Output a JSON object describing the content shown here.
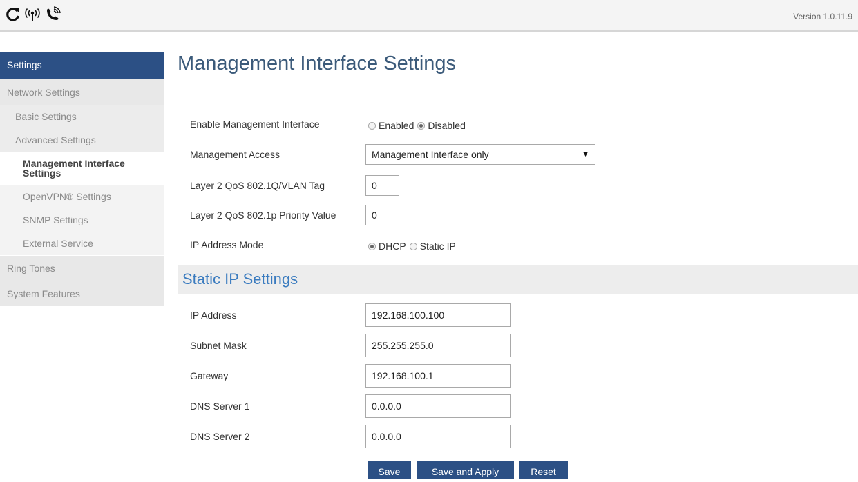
{
  "header": {
    "version": "Version 1.0.11.9"
  },
  "sidebar": {
    "title": "Settings",
    "items": [
      {
        "label": "Network Settings"
      },
      {
        "label": "Basic Settings"
      },
      {
        "label": "Advanced Settings"
      },
      {
        "label": "Management Interface Settings"
      },
      {
        "label": "OpenVPN® Settings"
      },
      {
        "label": "SNMP Settings"
      },
      {
        "label": "External Service"
      },
      {
        "label": "Ring Tones"
      },
      {
        "label": "System Features"
      }
    ]
  },
  "main": {
    "title": "Management Interface Settings",
    "enable_mgmt": {
      "label": "Enable Management Interface",
      "options": [
        "Enabled",
        "Disabled"
      ],
      "selected": "Disabled"
    },
    "mgmt_access": {
      "label": "Management Access",
      "value": "Management Interface only"
    },
    "qos_vlan": {
      "label": "Layer 2 QoS 802.1Q/VLAN Tag",
      "value": "0"
    },
    "qos_priority": {
      "label": "Layer 2 QoS 802.1p Priority Value",
      "value": "0"
    },
    "ip_mode": {
      "label": "IP Address Mode",
      "options": [
        "DHCP",
        "Static IP"
      ],
      "selected": "DHCP"
    },
    "static_section": {
      "title": "Static IP Settings",
      "ip_address": {
        "label": "IP Address",
        "value": "192.168.100.100"
      },
      "subnet_mask": {
        "label": "Subnet Mask",
        "value": "255.255.255.0"
      },
      "gateway": {
        "label": "Gateway",
        "value": "192.168.100.1"
      },
      "dns1": {
        "label": "DNS Server 1",
        "value": "0.0.0.0"
      },
      "dns2": {
        "label": "DNS Server 2",
        "value": "0.0.0.0"
      }
    },
    "buttons": {
      "save": "Save",
      "save_apply": "Save and Apply",
      "reset": "Reset"
    }
  },
  "colors": {
    "accent": "#2c5085",
    "section_title": "#3a7bbf"
  }
}
